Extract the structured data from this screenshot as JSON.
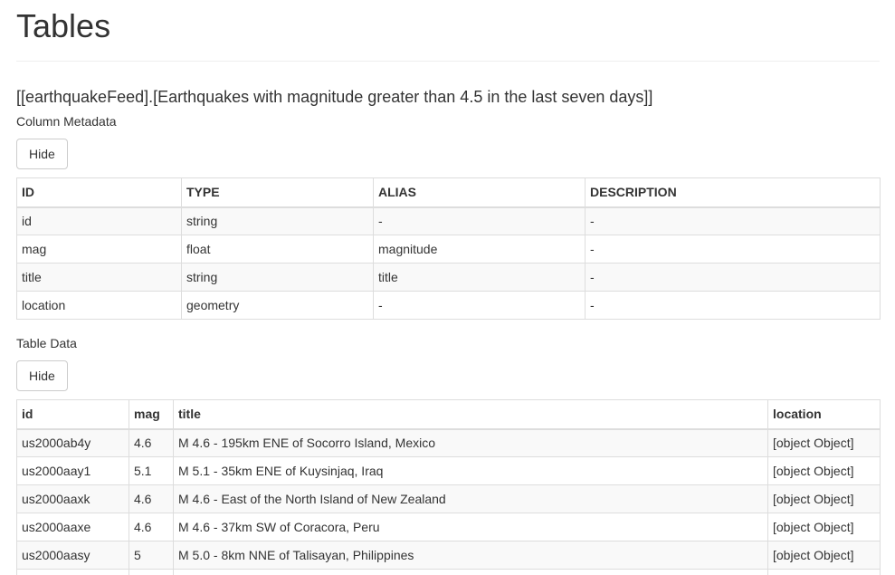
{
  "page": {
    "title": "Tables",
    "table_name": "[[earthquakeFeed].[Earthquakes with magnitude greater than 4.5 in the last seven days]]"
  },
  "column_metadata": {
    "label": "Column Metadata",
    "button_label": "Hide",
    "headers": [
      "ID",
      "TYPE",
      "ALIAS",
      "DESCRIPTION"
    ],
    "rows": [
      [
        "id",
        "string",
        "-",
        "-"
      ],
      [
        "mag",
        "float",
        "magnitude",
        "-"
      ],
      [
        "title",
        "string",
        "title",
        "-"
      ],
      [
        "location",
        "geometry",
        "-",
        "-"
      ]
    ]
  },
  "table_data": {
    "label": "Table Data",
    "button_label": "Hide",
    "headers": [
      "id",
      "mag",
      "title",
      "location"
    ],
    "rows": [
      [
        "us2000ab4y",
        "4.6",
        "M 4.6 - 195km ENE of Socorro Island, Mexico",
        "[object Object]"
      ],
      [
        "us2000aay1",
        "5.1",
        "M 5.1 - 35km ENE of Kuysinjaq, Iraq",
        "[object Object]"
      ],
      [
        "us2000aaxk",
        "4.6",
        "M 4.6 - East of the North Island of New Zealand",
        "[object Object]"
      ],
      [
        "us2000aaxe",
        "4.6",
        "M 4.6 - 37km SW of Coracora, Peru",
        "[object Object]"
      ],
      [
        "us2000aasy",
        "5",
        "M 5.0 - 8km NNE of Talisayan, Philippines",
        "[object Object]"
      ],
      [
        "",
        "",
        "",
        ""
      ]
    ]
  }
}
